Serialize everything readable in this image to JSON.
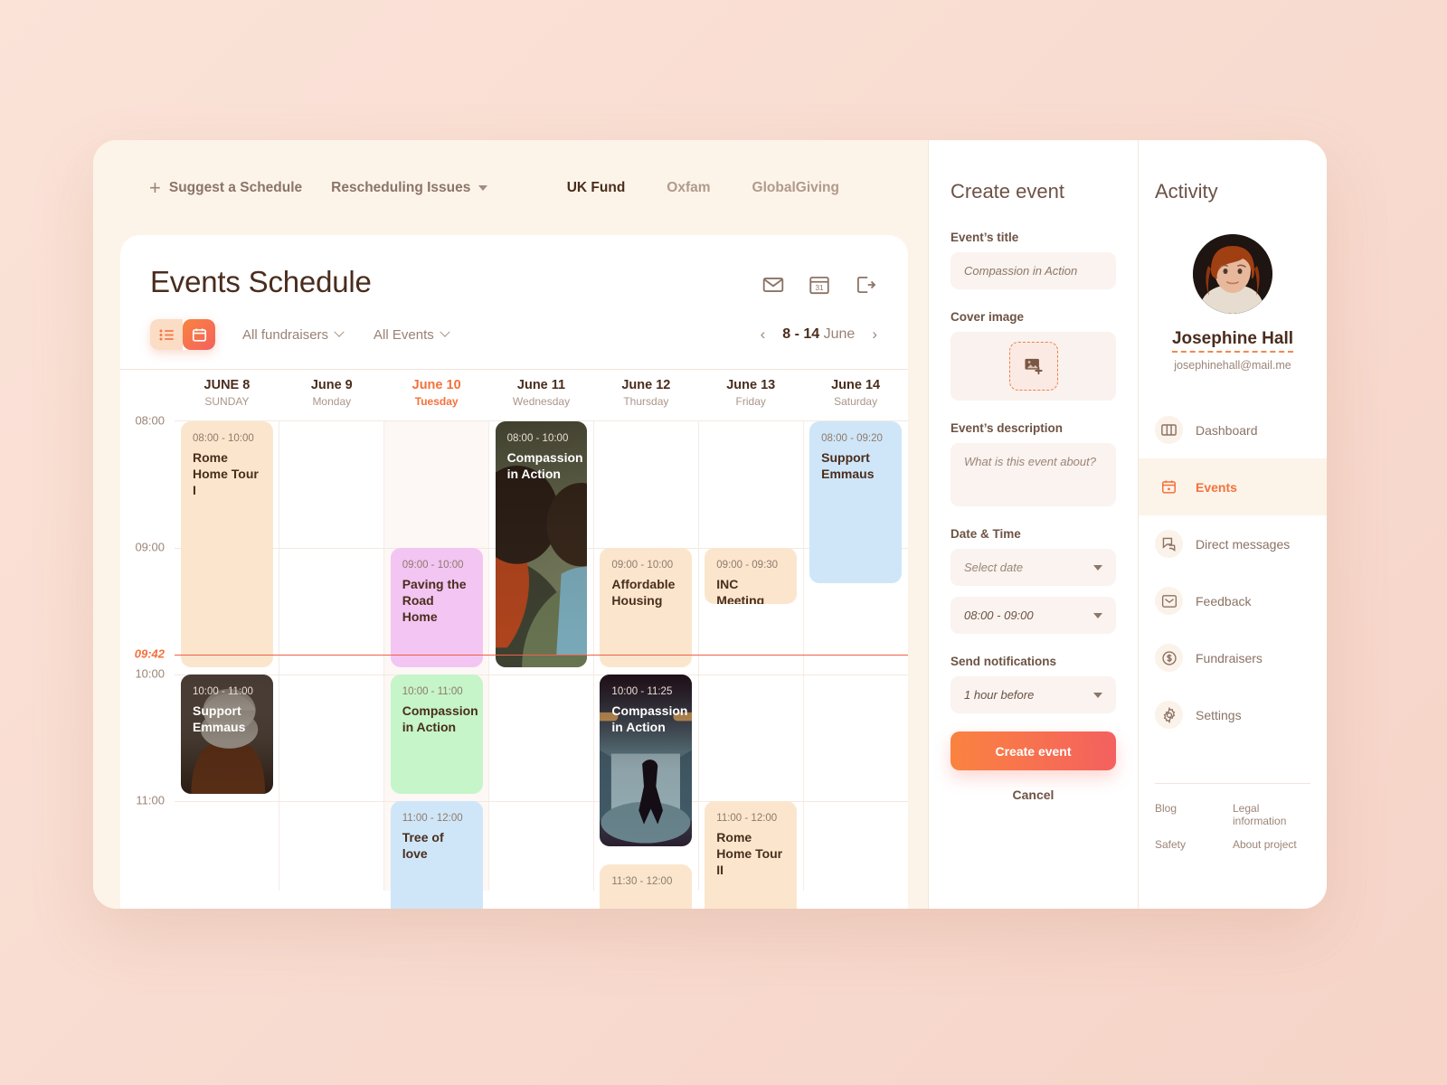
{
  "topbar": {
    "suggest_label": "Suggest a Schedule",
    "rescheduling_label": "Rescheduling Issues",
    "funds": [
      {
        "label": "UK Fund",
        "active": true
      },
      {
        "label": "Oxfam",
        "active": false
      },
      {
        "label": "GlobalGiving",
        "active": false
      }
    ]
  },
  "schedule": {
    "title": "Events Schedule",
    "header_icons": [
      "mail-icon",
      "calendar-icon",
      "logout-icon"
    ],
    "view_toggle": {
      "list": "list-view-icon",
      "calendar": "calendar-view-icon",
      "selected": "calendar"
    },
    "filters": [
      {
        "label": "All fundraisers"
      },
      {
        "label": "All Events"
      }
    ],
    "week_range_bold": "8 - 14",
    "week_range_rest": "June",
    "prev_arrow": "‹",
    "next_arrow": "›",
    "days": [
      {
        "date": "JUNE 8",
        "name": "SUNDAY",
        "today": false
      },
      {
        "date": "June 9",
        "name": "Monday",
        "today": false
      },
      {
        "date": "June 10",
        "name": "Tuesday",
        "today": true
      },
      {
        "date": "June 11",
        "name": "Wednesday",
        "today": false
      },
      {
        "date": "June 12",
        "name": "Thursday",
        "today": false
      },
      {
        "date": "June 13",
        "name": "Friday",
        "today": false
      },
      {
        "date": "June 14",
        "name": "Saturday",
        "today": false
      }
    ],
    "time_labels": [
      "08:00",
      "09:00",
      "10:00",
      "11:00"
    ],
    "current_time": "09:42",
    "events": [
      {
        "id": "e1",
        "day": 0,
        "time": "08:00 - 10:00",
        "title": "Rome Home Tour I",
        "style": "peach"
      },
      {
        "id": "e2",
        "day": 3,
        "time": "08:00 - 10:00",
        "title": "Compassion in Action",
        "style": "photo-hug"
      },
      {
        "id": "e3",
        "day": 6,
        "time": "08:00 - 09:20",
        "title": "Support Emmaus",
        "style": "blue"
      },
      {
        "id": "e4",
        "day": 2,
        "time": "09:00 - 10:00",
        "title": "Paving the Road Home",
        "style": "pink"
      },
      {
        "id": "e5",
        "day": 4,
        "time": "09:00 - 10:00",
        "title": "Affordable Housing",
        "style": "peach"
      },
      {
        "id": "e6",
        "day": 5,
        "time": "09:00 - 09:30",
        "title": "INC Meeting",
        "style": "peach"
      },
      {
        "id": "e7",
        "day": 0,
        "time": "10:00 - 11:00",
        "title": "Support Emmaus",
        "style": "photo-beanie"
      },
      {
        "id": "e8",
        "day": 2,
        "time": "10:00 - 11:00",
        "title": "Compassion in Action",
        "style": "green"
      },
      {
        "id": "e9",
        "day": 4,
        "time": "10:00 - 11:25",
        "title": "Compassion in Action",
        "style": "photo-tunnel"
      },
      {
        "id": "e10",
        "day": 2,
        "time": "11:00 - 12:00",
        "title": "Tree of love",
        "style": "blue"
      },
      {
        "id": "e11",
        "day": 5,
        "time": "11:00 - 12:00",
        "title": "Rome Home Tour II",
        "style": "peach"
      },
      {
        "id": "e12",
        "day": 4,
        "time": "11:30 - 12:00",
        "title": "",
        "style": "peach"
      }
    ]
  },
  "create_event": {
    "panel_title": "Create event",
    "title_label": "Event’s title",
    "title_value": "Compassion in Action",
    "cover_label": "Cover image",
    "cover_icon": "image-add-icon",
    "desc_label": "Event’s description",
    "desc_placeholder": "What is this event about?",
    "datetime_label": "Date & Time",
    "date_placeholder": "Select date",
    "time_value": "08:00 - 09:00",
    "notify_label": "Send notifications",
    "notify_value": "1 hour before",
    "submit_label": "Create event",
    "cancel_label": "Cancel"
  },
  "activity": {
    "panel_title": "Activity",
    "user_name": "Josephine Hall",
    "user_email": "josephinehall@mail.me",
    "nav": [
      {
        "label": "Dashboard",
        "icon": "dashboard-icon",
        "active": false
      },
      {
        "label": "Events",
        "icon": "calendar-icon",
        "active": true
      },
      {
        "label": "Direct messages",
        "icon": "chat-bubbles-icon",
        "active": false
      },
      {
        "label": "Feedback",
        "icon": "feedback-mail-icon",
        "active": false
      },
      {
        "label": "Fundraisers",
        "icon": "dollar-circle-icon",
        "active": false
      },
      {
        "label": "Settings",
        "icon": "gear-icon",
        "active": false
      }
    ],
    "footer_links": [
      "Blog",
      "Legal information",
      "Safety",
      "About project"
    ]
  },
  "colors": {
    "accent_orange": "#f4713c",
    "gradient_from": "#fa8340",
    "gradient_to": "#f4605f",
    "peach_card": "#fbe6cd",
    "blue_card": "#cfe6f8",
    "pink_card": "#f3c5f2",
    "green_card": "#c5f5c8",
    "now_line": "#f0604a"
  }
}
